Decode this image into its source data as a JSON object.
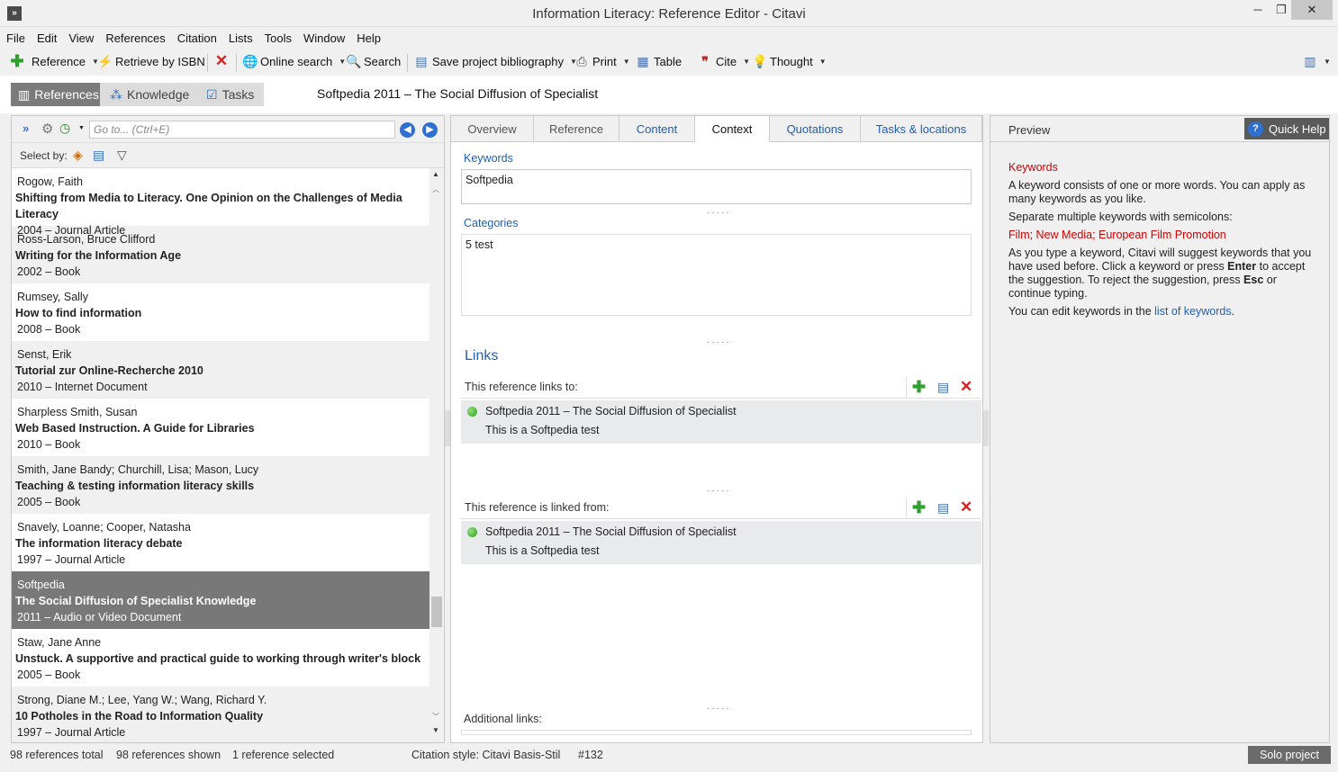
{
  "window": {
    "title": "Information Literacy: Reference Editor - Citavi"
  },
  "menu": [
    "File",
    "Edit",
    "View",
    "References",
    "Citation",
    "Lists",
    "Tools",
    "Window",
    "Help"
  ],
  "toolbar": {
    "reference": "Reference",
    "retrieve": "Retrieve by ISBN",
    "online_search": "Online search",
    "search": "Search",
    "save_bib": "Save project bibliography",
    "print": "Print",
    "table": "Table",
    "cite": "Cite",
    "thought": "Thought"
  },
  "modes": {
    "references": "References",
    "knowledge": "Knowledge",
    "tasks": "Tasks"
  },
  "current_reference_title": "Softpedia 2011 – The Social Diffusion of Specialist",
  "left": {
    "goto_placeholder": "Go to... (Ctrl+E)",
    "select_by": "Select by:",
    "references": [
      {
        "author": "Rogow, Faith",
        "title": "Shifting from Media to Literacy. One Opinion on the Challenges of Media Literacy",
        "meta": "2004 – Journal Article"
      },
      {
        "author": "Ross-Larson, Bruce Clifford",
        "title": "Writing for the Information Age",
        "meta": "2002 – Book"
      },
      {
        "author": "Rumsey, Sally",
        "title": "How to find information",
        "meta": "2008 – Book"
      },
      {
        "author": "Senst, Erik",
        "title": "Tutorial zur Online-Recherche 2010",
        "meta": "2010 – Internet Document"
      },
      {
        "author": "Sharpless Smith, Susan",
        "title": "Web Based Instruction. A Guide for Libraries",
        "meta": "2010 – Book"
      },
      {
        "author": "Smith, Jane Bandy; Churchill, Lisa; Mason, Lucy",
        "title": "Teaching & testing information literacy skills",
        "meta": "2005 – Book"
      },
      {
        "author": "Snavely, Loanne; Cooper, Natasha",
        "title": "The information literacy debate",
        "meta": "1997 – Journal Article"
      },
      {
        "author": "Softpedia",
        "title": "The Social Diffusion of Specialist Knowledge",
        "meta": "2011 – Audio or Video Document"
      },
      {
        "author": "Staw, Jane Anne",
        "title": "Unstuck. A supportive and practical guide to working through writer's block",
        "meta": "2005 – Book"
      },
      {
        "author": "Strong, Diane M.; Lee, Yang W.; Wang, Richard Y.",
        "title": "10 Potholes in the Road to Information Quality",
        "meta": "1997 – Journal Article"
      }
    ]
  },
  "tabs": [
    "Overview",
    "Reference",
    "Content",
    "Context",
    "Quotations",
    "Tasks & locations"
  ],
  "context": {
    "keywords_label": "Keywords",
    "keywords_value": "Softpedia",
    "categories_label": "Categories",
    "categories_value": "5 test",
    "links_heading": "Links",
    "links_to_label": "This reference links to:",
    "links_from_label": "This reference is linked from:",
    "link_to": {
      "title": "Softpedia 2011 – The Social Diffusion of Specialist",
      "note": "This is a Softpedia test"
    },
    "link_from": {
      "title": "Softpedia 2011 – The Social Diffusion of Specialist",
      "note": "This is a Softpedia test"
    },
    "additional_links_label": "Additional links:"
  },
  "preview": {
    "label": "Preview",
    "quick_help": "Quick Help",
    "help_heading": "Keywords",
    "p1": "A keyword consists of one or more words. You can apply as many keywords as you like.",
    "p2": "Separate multiple keywords with semicolons:",
    "example": "Film; New Media; European Film Promotion",
    "p3a": "As you type a keyword, Citavi will suggest keywords that you have used before. Click a keyword or press ",
    "p3b": "Enter",
    "p3c": " to accept the suggestion. To reject the suggestion, press ",
    "p3d": "Esc",
    "p3e": " or continue typing.",
    "p4a": "You can edit keywords in the ",
    "p4link": "list of keywords",
    "p4b": "."
  },
  "status": {
    "total": "98 references total",
    "shown": "98 references shown",
    "selected": "1 reference selected",
    "style": "Citation style: Citavi Basis-Stil",
    "number": "#132",
    "project": "Solo project"
  },
  "colors": {
    "accent_blue": "#1f5fb5",
    "help_red": "#d00000",
    "selected_row": "#787878"
  }
}
